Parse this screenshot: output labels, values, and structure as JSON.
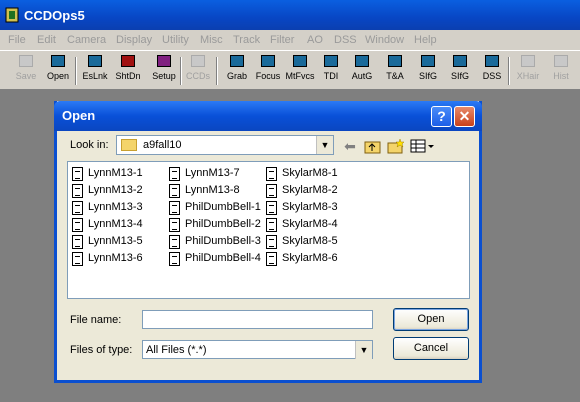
{
  "app": {
    "title": "CCDOps5"
  },
  "menu": [
    "File",
    "Edit",
    "Camera",
    "Display",
    "Utility",
    "Misc",
    "Track",
    "Filter",
    "AO",
    "DSS",
    "Window",
    "Help"
  ],
  "toolbar": [
    {
      "label": "Save",
      "icon": "S",
      "enabled": false
    },
    {
      "label": "Open",
      "icon": "O",
      "enabled": true
    },
    {
      "label": "EsLnk",
      "icon": "L",
      "enabled": true
    },
    {
      "label": "ShtDn",
      "icon": "SD",
      "enabled": true
    },
    {
      "label": "Setup",
      "icon": "S",
      "enabled": true
    },
    {
      "label": "CCDs",
      "icon": "CCD",
      "enabled": false
    },
    {
      "label": "Grab",
      "icon": "G",
      "enabled": true
    },
    {
      "label": "Focus",
      "icon": "F",
      "enabled": true
    },
    {
      "label": "MtFvcs",
      "icon": "MF",
      "enabled": true
    },
    {
      "label": "TDI",
      "icon": "TDI",
      "enabled": true
    },
    {
      "label": "AutG",
      "icon": "AG",
      "enabled": true
    },
    {
      "label": "T&A",
      "icon": "TA",
      "enabled": true
    },
    {
      "label": "SIfG",
      "icon": "SG",
      "enabled": true
    },
    {
      "label": "SIfG",
      "icon": "AO",
      "enabled": true
    },
    {
      "label": "DSS",
      "icon": "D",
      "enabled": true
    },
    {
      "label": "XHair",
      "icon": "X",
      "enabled": false
    },
    {
      "label": "Hist",
      "icon": "H",
      "enabled": false
    }
  ],
  "dialog": {
    "title": "Open",
    "help_glyph": "?",
    "close_glyph": "✕",
    "look_in_label": "Look in:",
    "look_in_value": "a9fall10",
    "file_name_label": "File name:",
    "file_name_value": "",
    "files_of_type_label": "Files of type:",
    "files_of_type_value": "All Files (*.*)",
    "open_label": "Open",
    "cancel_label": "Cancel",
    "files": [
      "LynnM13-1",
      "LynnM13-2",
      "LynnM13-3",
      "LynnM13-4",
      "LynnM13-5",
      "LynnM13-6",
      "LynnM13-7",
      "LynnM13-8",
      "PhilDumbBell-1",
      "PhilDumbBell-2",
      "PhilDumbBell-3",
      "PhilDumbBell-4",
      "SkylarM8-1",
      "SkylarM8-2",
      "SkylarM8-3",
      "SkylarM8-4",
      "SkylarM8-5",
      "SkylarM8-6"
    ]
  },
  "colors": {
    "titlebar": "#0846c4",
    "close": "#c8401a",
    "folder": "#f4d46a"
  }
}
